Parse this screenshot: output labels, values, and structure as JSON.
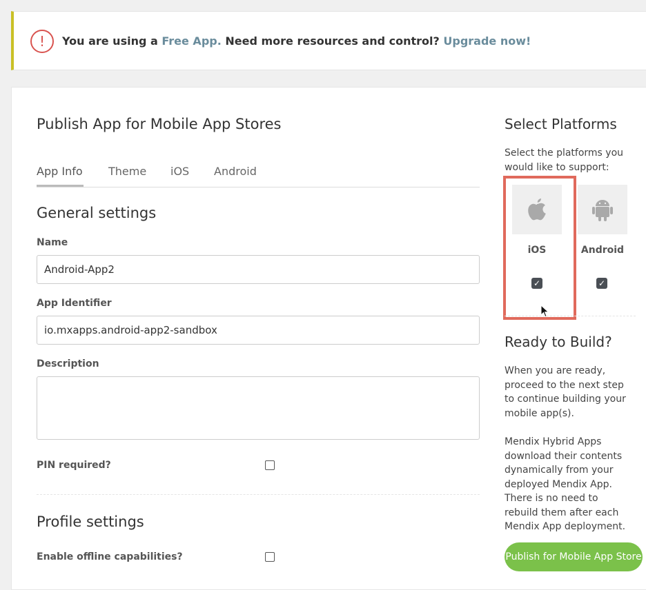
{
  "banner": {
    "prefix": "You are using a ",
    "link_free_app": "Free App.",
    "middle": " Need more resources and control? ",
    "link_upgrade": "Upgrade now!",
    "icon": "alert-circle-icon"
  },
  "main": {
    "title": "Publish App for Mobile App Stores",
    "tabs": [
      {
        "label": "App Info",
        "active": true
      },
      {
        "label": "Theme"
      },
      {
        "label": "iOS"
      },
      {
        "label": "Android"
      }
    ],
    "general_settings": {
      "title": "General settings",
      "name_label": "Name",
      "name_value": "Android-App2",
      "app_identifier_label": "App Identifier",
      "app_identifier_value": "io.mxapps.android-app2-sandbox",
      "description_label": "Description",
      "description_value": "",
      "pin_label": "PIN required?",
      "pin_checked": false
    },
    "profile_settings": {
      "title": "Profile settings",
      "offline_label": "Enable offline capabilities?",
      "offline_checked": false
    }
  },
  "sidebar": {
    "select_platforms_title": "Select Platforms",
    "select_platforms_text": "Select the platforms you would like to support:",
    "platforms": [
      {
        "label": "iOS",
        "icon": "apple-icon",
        "checked": true
      },
      {
        "label": "Android",
        "icon": "android-icon",
        "checked": true
      }
    ],
    "ready_title": "Ready to Build?",
    "ready_text_1": "When you are ready, proceed to the next step to continue building your mobile app(s).",
    "ready_text_2": "Mendix Hybrid Apps download their contents dynamically from your deployed Mendix App. There is no need to rebuild them after each Mendix App deployment.",
    "publish_button": "Publish for Mobile App Store"
  },
  "colors": {
    "link": "#6a8c9c",
    "banner_accent": "#c9c026",
    "alert": "#d9534f",
    "publish_button": "#7bc14a",
    "highlight": "#e06a5c"
  }
}
